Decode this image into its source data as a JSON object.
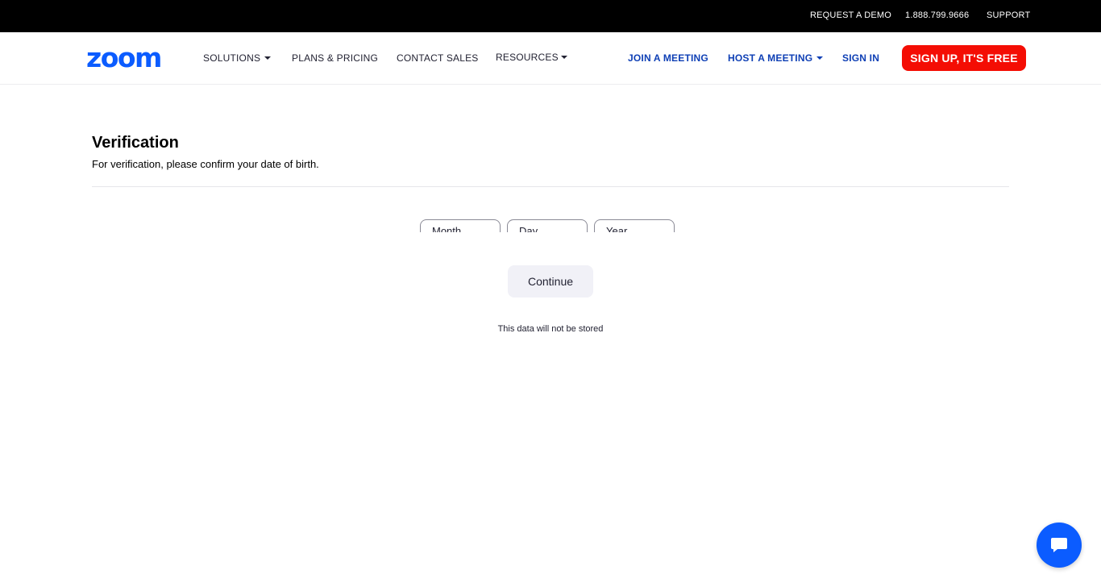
{
  "topbar": {
    "request_demo": "REQUEST A DEMO",
    "phone": "1.888.799.9666",
    "support": "SUPPORT"
  },
  "nav": {
    "logo": "zoom",
    "solutions": "SOLUTIONS",
    "plans_pricing": "PLANS & PRICING",
    "contact_sales": "CONTACT SALES",
    "resources": "RESOURCES",
    "join_meeting": "JOIN A MEETING",
    "host_meeting": "HOST A MEETING",
    "sign_in": "SIGN IN",
    "sign_up": "SIGN UP, IT'S FREE"
  },
  "verification": {
    "title": "Verification",
    "subtitle": "For verification, please confirm your date of birth.",
    "month": "Month",
    "day": "Day",
    "year": "Year",
    "continue": "Continue",
    "note": "This data will not be stored"
  },
  "colors": {
    "brand": "#0b5cff",
    "signup": "#f40d04",
    "nav_link": "#0e3fb5"
  },
  "icons": {
    "chat": "chat-bubble-icon",
    "caret": "caret-down-icon"
  }
}
